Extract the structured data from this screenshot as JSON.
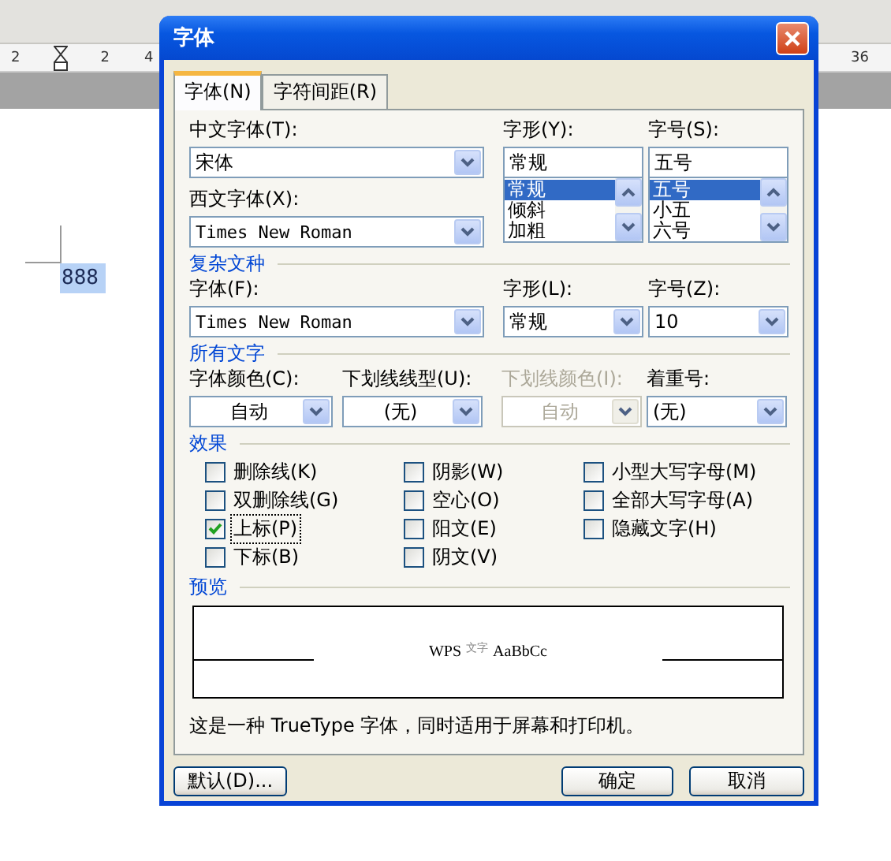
{
  "app": {
    "ruler": {
      "labels": [
        "2",
        "2",
        "4",
        "36"
      ]
    },
    "document": {
      "text": "888",
      "selected": true
    }
  },
  "dialog": {
    "title": "字体",
    "tabs": [
      {
        "label": "字体(N)",
        "selected": true
      },
      {
        "label": "字符间距(R)",
        "selected": false
      }
    ],
    "chinese_font": {
      "label": "中文字体(T):",
      "value": "宋体"
    },
    "western_font": {
      "label": "西文字体(X):",
      "value": "Times New Roman"
    },
    "style": {
      "label": "字形(Y):",
      "value": "常规",
      "options": [
        {
          "label": "常规",
          "selected": true
        },
        {
          "label": "倾斜",
          "selected": false
        },
        {
          "label": "加粗",
          "selected": false
        }
      ]
    },
    "size": {
      "label": "字号(S):",
      "value": "五号",
      "options": [
        {
          "label": "五号",
          "selected": true
        },
        {
          "label": "小五",
          "selected": false
        },
        {
          "label": "六号",
          "selected": false
        }
      ]
    },
    "complex_script": {
      "heading": "复杂文种",
      "font": {
        "label": "字体(F):",
        "value": "Times New Roman"
      },
      "style": {
        "label": "字形(L):",
        "value": "常规"
      },
      "size": {
        "label": "字号(Z):",
        "value": "10"
      }
    },
    "all_text": {
      "heading": "所有文字",
      "fields": [
        {
          "label": "字体颜色(C):",
          "value": "自动",
          "disabled": false
        },
        {
          "label": "下划线线型(U):",
          "value": "(无)",
          "disabled": false
        },
        {
          "label": "下划线颜色(I):",
          "value": "自动",
          "disabled": true
        },
        {
          "label": "着重号:",
          "value": "(无)",
          "disabled": false
        }
      ]
    },
    "effects": {
      "heading": "效果",
      "items": [
        {
          "label": "删除线(K)",
          "checked": false,
          "focused": false
        },
        {
          "label": "双删除线(G)",
          "checked": false,
          "focused": false
        },
        {
          "label": "上标(P)",
          "checked": true,
          "focused": true
        },
        {
          "label": "下标(B)",
          "checked": false,
          "focused": false
        },
        {
          "label": "阴影(W)",
          "checked": false,
          "focused": false
        },
        {
          "label": "空心(O)",
          "checked": false,
          "focused": false
        },
        {
          "label": "阳文(E)",
          "checked": false,
          "focused": false
        },
        {
          "label": "阴文(V)",
          "checked": false,
          "focused": false
        },
        {
          "label": "小型大写字母(M)",
          "checked": false,
          "focused": false
        },
        {
          "label": "全部大写字母(A)",
          "checked": false,
          "focused": false
        },
        {
          "label": "隐藏文字(H)",
          "checked": false,
          "focused": false
        }
      ]
    },
    "preview": {
      "heading": "预览",
      "parts": [
        {
          "text": "WPS",
          "kind": "normal"
        },
        {
          "text": "文字",
          "kind": "superscript"
        },
        {
          "text": "AaBbCc",
          "kind": "normal"
        }
      ]
    },
    "note": "这是一种 TrueType 字体，同时适用于屏幕和打印机。",
    "buttons": [
      {
        "label": "默认(D)...",
        "kind": "default"
      },
      {
        "label": "确定",
        "kind": "ok"
      },
      {
        "label": "取消",
        "kind": "cancel"
      }
    ]
  }
}
